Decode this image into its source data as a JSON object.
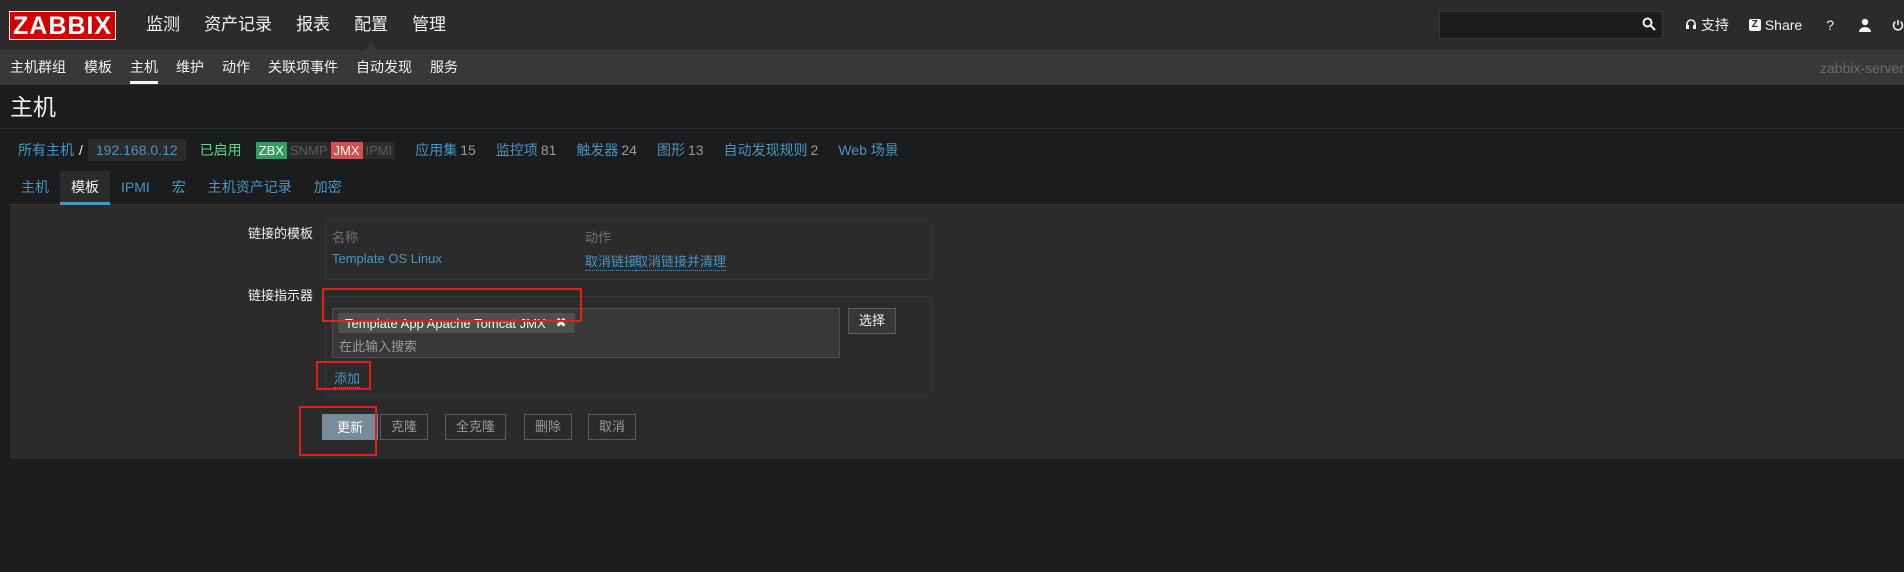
{
  "header": {
    "logo": "ZABBIX",
    "menu": [
      "监测",
      "资产记录",
      "报表",
      "配置",
      "管理"
    ],
    "support_label": "支持",
    "share_label": "Share",
    "help_label": "?"
  },
  "submenu": {
    "items": [
      "主机群组",
      "模板",
      "主机",
      "维护",
      "动作",
      "关联项事件",
      "自动发现",
      "服务"
    ],
    "server_name": "zabbix-server"
  },
  "page_title": "主机",
  "breadcrumbs": {
    "all_hosts": "所有主机",
    "separator": "/",
    "host": "192.168.0.12",
    "status": "已启用",
    "badges": [
      "ZBX",
      "SNMP",
      "JMX",
      "IPMI"
    ],
    "stats": [
      {
        "label": "应用集",
        "count": "15"
      },
      {
        "label": "监控项",
        "count": "81"
      },
      {
        "label": "触发器",
        "count": "24"
      },
      {
        "label": "图形",
        "count": "13"
      },
      {
        "label": "自动发现规则",
        "count": "2"
      },
      {
        "label": "Web 场景",
        "count": ""
      }
    ]
  },
  "tabs": [
    "主机",
    "模板",
    "IPMI",
    "宏",
    "主机资产记录",
    "加密"
  ],
  "form": {
    "linked_templates_label": "链接的模板",
    "col_name": "名称",
    "col_action": "动作",
    "template_name": "Template OS Linux",
    "unlink": "取消链接",
    "unlink_clear": "取消链接并清理",
    "link_indicator_label": "链接指示器",
    "selected_template": "Template App Apache Tomcat JMX",
    "search_placeholder": "在此输入搜索",
    "select_button": "选择",
    "add_link": "添加"
  },
  "buttons": {
    "update": "更新",
    "clone": "克隆",
    "full_clone": "全克隆",
    "delete": "删除",
    "cancel": "取消"
  },
  "colors": {
    "accent": "#4796c4",
    "logo": "#d40000",
    "highlight": "#e0201f"
  }
}
